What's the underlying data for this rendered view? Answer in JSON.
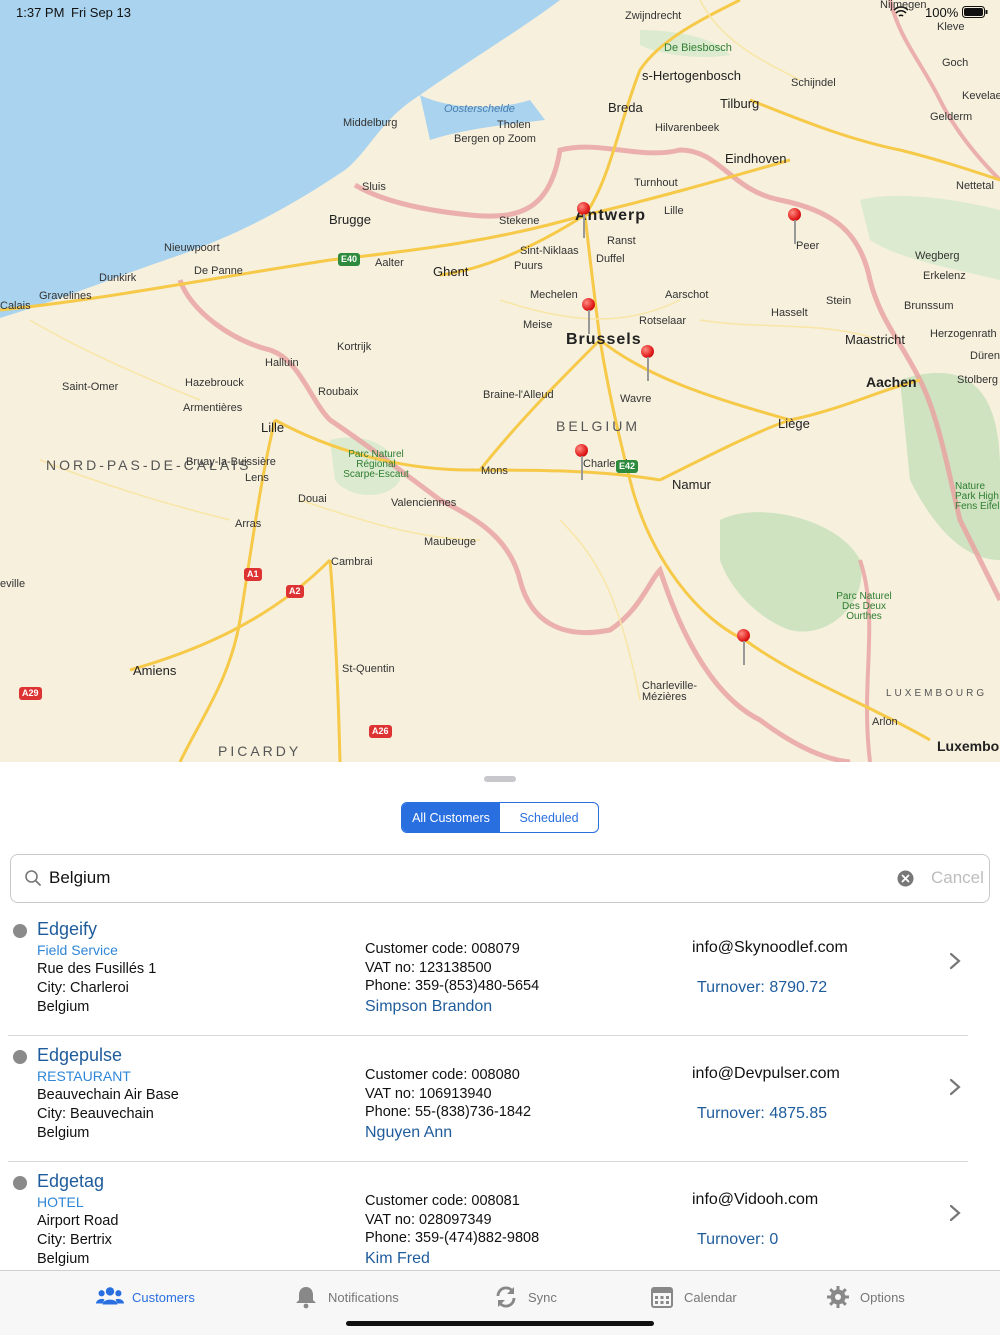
{
  "status_bar": {
    "time": "1:37 PM",
    "date": "Fri Sep 13",
    "battery": "100%"
  },
  "map": {
    "big_cities": [
      "Antwerp",
      "Brussels",
      "Aachen"
    ],
    "cities": [
      "Brugge",
      "Ghent",
      "Breda",
      "Tilburg",
      "Eindhoven",
      "Mechelen",
      "Namur",
      "Liège",
      "Maastricht",
      "Lille",
      "Kortrijk",
      "Mons",
      "Charleroi",
      "Amiens",
      "Zwijndrecht",
      "s-Hertogenbosch",
      "Turnhout",
      "Hasselt",
      "Wavre",
      "Valenciennes",
      "Cambrai",
      "Arras",
      "Douai",
      "Roubaix",
      "Halluin",
      "Lens",
      "Maubeuge",
      "St-Quentin",
      "Charleville-Mézières",
      "Arlon",
      "Luxembo"
    ],
    "towns": [
      "Sluis",
      "Nieuwpoort",
      "Dunkirk",
      "De Panne",
      "Gravelines",
      "Calais",
      "Saint-Omer",
      "Hazebrouck",
      "Armentières",
      "Bruay-la-Buissière",
      "Aalter",
      "Stekene",
      "Sint-Niklaas",
      "Puurs",
      "Ranst",
      "Duffel",
      "Lille",
      "Aarschot",
      "Rotselaar",
      "Meise",
      "Braine-l'Alleud",
      "Middelburg",
      "Tholen",
      "Bergen op Zoom",
      "Hilvarenbeek",
      "Schijndel",
      "Kleve",
      "Goch",
      "Kevelae",
      "Gelderm",
      "Nettetal",
      "Peer",
      "Wegberg",
      "Erkelenz",
      "Stein",
      "Brunssum",
      "Herzogenrath",
      "Düren",
      "Stolberg",
      "eville",
      "Nijmegen"
    ],
    "regions": [
      "NORD-PAS-DE-CALAIS",
      "BELGIUM",
      "PICARDY",
      "LUXEMBOURG"
    ],
    "water": [
      "Oosterschelde"
    ],
    "parks": [
      "De Biesbosch",
      "Parc Naturel Régional Scarpe-Escaut",
      "Parc Naturel Des Deux Ourthes",
      "Nature Park High Fens Eifel"
    ],
    "shields": [
      "E40",
      "E42",
      "A1",
      "A2",
      "A29",
      "A26"
    ],
    "pin_count": 6
  },
  "segments": [
    {
      "label": "All Customers",
      "active": true
    },
    {
      "label": "Scheduled",
      "active": false
    }
  ],
  "search": {
    "value": "Belgium",
    "cancel": "Cancel"
  },
  "customers": [
    {
      "name": "Edgeify",
      "type": "Field Service",
      "address": "Rue des Fusillés 1",
      "city": "City: Charleroi",
      "country": "Belgium",
      "code": "Customer code: 008079",
      "vat": "VAT no: 123138500",
      "phone": "Phone: 359-(853)480-5654",
      "contact": "Simpson Brandon",
      "email": "info@Skynoodlef.com",
      "turnover": "Turnover: 8790.72"
    },
    {
      "name": "Edgepulse",
      "type": "RESTAURANT",
      "address": "Beauvechain Air Base",
      "city": "City: Beauvechain",
      "country": "Belgium",
      "code": "Customer code: 008080",
      "vat": "VAT no: 106913940",
      "phone": "Phone: 55-(838)736-1842",
      "contact": "Nguyen Ann",
      "email": "info@Devpulser.com",
      "turnover": "Turnover: 4875.85"
    },
    {
      "name": "Edgetag",
      "type": "HOTEL",
      "address": "Airport Road",
      "city": "City: Bertrix",
      "country": "Belgium",
      "code": "Customer code: 008081",
      "vat": "VAT no: 028097349",
      "phone": "Phone: 359-(474)882-9808",
      "contact": "Kim Fred",
      "email": "info@Vidooh.com",
      "turnover": "Turnover: 0"
    }
  ],
  "tabs": [
    {
      "label": "Customers",
      "icon": "people-icon",
      "active": true
    },
    {
      "label": "Notifications",
      "icon": "bell-icon",
      "active": false
    },
    {
      "label": "Sync",
      "icon": "sync-icon",
      "active": false
    },
    {
      "label": "Calendar",
      "icon": "calendar-icon",
      "active": false
    },
    {
      "label": "Options",
      "icon": "gear-icon",
      "active": false
    }
  ],
  "colors": {
    "accent": "#2a6fe0",
    "link": "#1f5c9c",
    "pin": "#e01b1b",
    "sea": "#a9d3ee",
    "land": "#f6f0dd",
    "forest": "#cfe3c0",
    "border": "#e8a0a0",
    "road": "#f7c948"
  }
}
